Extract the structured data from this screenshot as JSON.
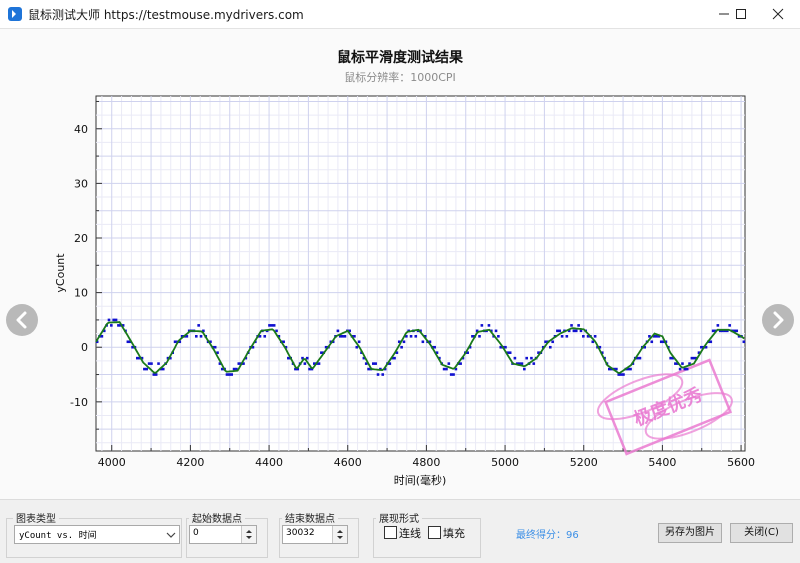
{
  "window": {
    "title": "鼠标测试大师 https://testmouse.mydrivers.com",
    "icons": {
      "minimize": "minimize-icon",
      "maximize": "maximize-icon",
      "close": "close-icon"
    }
  },
  "chart_data": {
    "type": "line",
    "title": "鼠标平滑度测试结果",
    "subtitle": "鼠标分辨率：1000CPI",
    "xlabel": "时间(毫秒)",
    "ylabel": "yCount",
    "xlim": [
      3960,
      5610
    ],
    "ylim": [
      -19,
      46
    ],
    "x_ticks": [
      4000,
      4200,
      4400,
      4600,
      4800,
      5000,
      5200,
      5400,
      5600
    ],
    "y_ticks": [
      40,
      30,
      20,
      10,
      0,
      -10
    ],
    "grid": true,
    "series": [
      {
        "color": "#1a7a1a",
        "x": [
          3960,
          3990,
          4020,
          4050,
          4080,
          4110,
          4140,
          4170,
          4200,
          4230,
          4260,
          4290,
          4320,
          4350,
          4380,
          4410,
          4440,
          4470,
          4490,
          4510,
          4540,
          4570,
          4600,
          4630,
          4660,
          4690,
          4720,
          4750,
          4780,
          4810,
          4840,
          4870,
          4900,
          4930,
          4960,
          4990,
          5020,
          5050,
          5080,
          5110,
          5140,
          5170,
          5200,
          5230,
          5260,
          5290,
          5320,
          5350,
          5380,
          5400,
          5420,
          5450,
          5480,
          5510,
          5540,
          5570,
          5600,
          5610
        ],
        "values": [
          1,
          4.5,
          4.6,
          1,
          -2.8,
          -4.8,
          -2.8,
          1.2,
          3,
          2.9,
          -0.5,
          -4.5,
          -4.3,
          -0.5,
          3,
          3.3,
          0,
          -4,
          -2,
          -4,
          -1,
          2,
          3,
          0,
          -4,
          -4.2,
          -1,
          2.8,
          3.2,
          0.5,
          -3.2,
          -4,
          -1,
          2.8,
          3.2,
          0.5,
          -3,
          -3.5,
          -2,
          1,
          2.5,
          3.5,
          3.3,
          1,
          -3.3,
          -4.8,
          -3.3,
          0,
          2.5,
          2,
          -1,
          -3.8,
          -3,
          0.5,
          3.2,
          3.2,
          2,
          1.5
        ]
      }
    ],
    "scatter_color": "#1010d0"
  },
  "nav": {
    "prev_icon": "chevron-left-icon",
    "next_icon": "chevron-right-icon"
  },
  "controls": {
    "chart_type": {
      "label": "图表类型",
      "value": "yCount vs. 时间"
    },
    "start_point": {
      "label": "起始数据点",
      "value": "0"
    },
    "end_point": {
      "label": "结束数据点",
      "value": "30032"
    },
    "display": {
      "label": "展现形式",
      "line_label": "连线",
      "fill_label": "填充",
      "line_checked": false,
      "fill_checked": false
    },
    "score": "最终得分：96",
    "save_image": "另存为图片",
    "close": "关闭(C)"
  },
  "stamp": {
    "text": "极度优秀"
  }
}
